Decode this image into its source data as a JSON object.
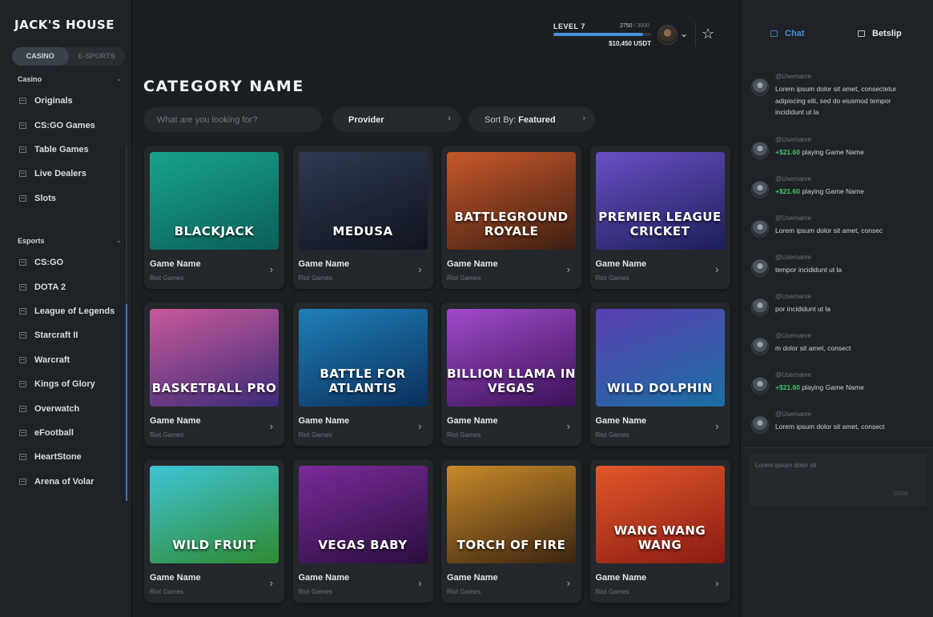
{
  "brand": "JACK'S HOUSE",
  "modes": [
    "CASINO",
    "E-SPORTS"
  ],
  "sidebar": {
    "casino_heading": "Casino",
    "casino_items": [
      "Originals",
      "CS:GO Games",
      "Table Games",
      "Live Dealers",
      "Slots"
    ],
    "esports_heading": "Esports",
    "esports_items": [
      "CS:GO",
      "DOTA 2",
      "League of Legends",
      "Starcraft II",
      "Warcraft",
      "Kings of Glory",
      "Overwatch",
      "eFootball",
      "HeartStone",
      "Arena of Volar"
    ]
  },
  "header": {
    "level": "LEVEL 7",
    "xp_current": "2750",
    "xp_total": "3000",
    "xp_fraction": 0.917,
    "balance": "$10,450 USDT"
  },
  "main": {
    "title": "CATEGORY NAME",
    "search_placeholder": "What are you looking for?",
    "provider_label": "Provider",
    "sort_prefix": "Sort By:",
    "sort_value": "Featured"
  },
  "games": [
    {
      "art": "BLACKJACK",
      "name": "Game Name",
      "provider": "Riot Games",
      "colors": [
        "#18a38c",
        "#0b5f57"
      ]
    },
    {
      "art": "MEDUSA",
      "name": "Game Name",
      "provider": "Riot Games",
      "colors": [
        "#2e3a52",
        "#10141e"
      ]
    },
    {
      "art": "BATTLEGROUND ROYALE",
      "name": "Game Name",
      "provider": "Riot Games",
      "colors": [
        "#c7572a",
        "#3d1f12"
      ]
    },
    {
      "art": "PREMIER LEAGUE CRICKET",
      "name": "Game Name",
      "provider": "Riot Games",
      "colors": [
        "#6a4fc4",
        "#1c1f5a"
      ]
    },
    {
      "art": "BASKETBALL PRO",
      "name": "Game Name",
      "provider": "Riot Games",
      "colors": [
        "#c95a9a",
        "#3a2a78"
      ]
    },
    {
      "art": "BATTLE FOR ATLANTIS",
      "name": "Game Name",
      "provider": "Riot Games",
      "colors": [
        "#1f7fb8",
        "#0a2f5c"
      ]
    },
    {
      "art": "BILLION LLAMA IN VEGAS",
      "name": "Game Name",
      "provider": "Riot Games",
      "colors": [
        "#a04ac9",
        "#3a1257"
      ]
    },
    {
      "art": "WILD DOLPHIN",
      "name": "Game Name",
      "provider": "Riot Games",
      "colors": [
        "#5a3fb0",
        "#1a6fa3"
      ]
    },
    {
      "art": "WILD FRUIT",
      "name": "Game Name",
      "provider": "Riot Games",
      "colors": [
        "#3fc4d6",
        "#2f8a2f"
      ]
    },
    {
      "art": "VEGAS BABY",
      "name": "Game Name",
      "provider": "Riot Games",
      "colors": [
        "#7a2a9a",
        "#2a0f3e"
      ]
    },
    {
      "art": "TORCH OF FIRE",
      "name": "Game Name",
      "provider": "Riot Games",
      "colors": [
        "#c98a2a",
        "#3a2410"
      ]
    },
    {
      "art": "WANG WANG WANG",
      "name": "Game Name",
      "provider": "Riot Games",
      "colors": [
        "#e0582a",
        "#8a1a12"
      ]
    }
  ],
  "chat": {
    "tabs": [
      "Chat",
      "Betslip"
    ],
    "messages": [
      {
        "user": "@Username",
        "amount": "",
        "text": "Lorem ipsum dolor sit amet, consectetur adipiscing elit, sed do eiusmod tempor incididunt ut la"
      },
      {
        "user": "@Username",
        "amount": "+$21.60",
        "text": " playing Game Name"
      },
      {
        "user": "@Username",
        "amount": "+$21.60",
        "text": " playing Game Name"
      },
      {
        "user": "@Username",
        "amount": "",
        "text": "Lorem ipsum dolor sit amet, consec"
      },
      {
        "user": "@Username",
        "amount": "",
        "text": "tempor incididunt ut la"
      },
      {
        "user": "@Username",
        "amount": "",
        "text": "por incididunt ut la"
      },
      {
        "user": "@Username",
        "amount": "",
        "text": "m dolor sit amet, consect"
      },
      {
        "user": "@Username",
        "amount": "+$21.60",
        "text": " playing Game Name"
      },
      {
        "user": "@Username",
        "amount": "",
        "text": "Lorem ipsum dolor sit amet, consect"
      }
    ],
    "input_placeholder": "Lorem ipsum dolor sit",
    "char_count": "0/200"
  },
  "colors": {
    "accent": "#4a8fd6",
    "win": "#42c46a",
    "bg": "#1b1e22",
    "panel": "#1f2226",
    "card": "#24272c"
  }
}
